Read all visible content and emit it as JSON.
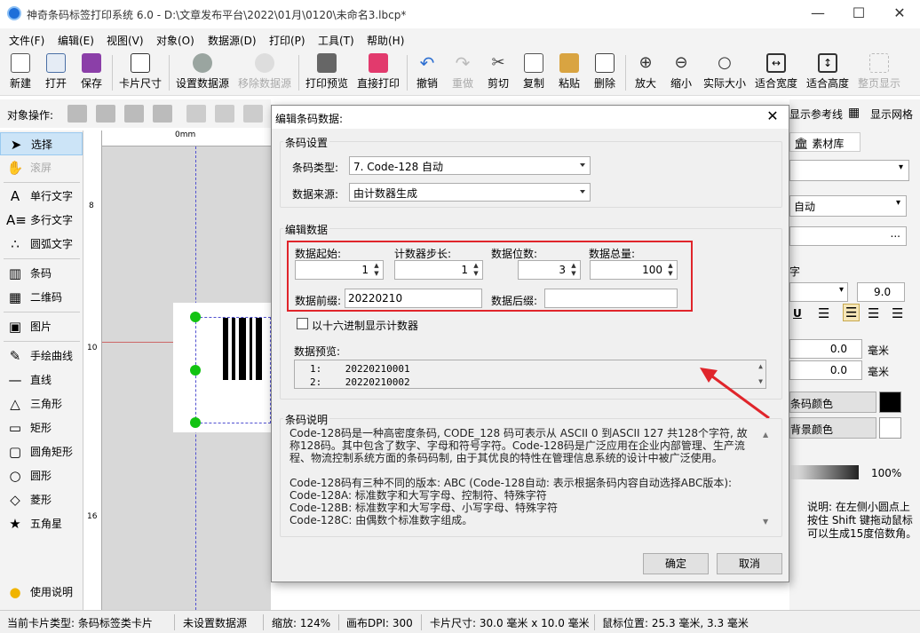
{
  "window": {
    "title": "神奇条码标签打印系统 6.0 - D:\\文章发布平台\\2022\\01月\\0120\\未命名3.lbcp*",
    "minimize": "—",
    "maximize": "☐",
    "close": "✕"
  },
  "menu": [
    "文件(F)",
    "编辑(E)",
    "视图(V)",
    "对象(O)",
    "数据源(D)",
    "打印(P)",
    "工具(T)",
    "帮助(H)"
  ],
  "toolbar": [
    "新建",
    "打开",
    "保存",
    "卡片尺寸",
    "设置数据源",
    "移除数据源",
    "打印预览",
    "直接打印",
    "撤销",
    "重做",
    "剪切",
    "复制",
    "粘贴",
    "删除",
    "放大",
    "缩小",
    "实际大小",
    "适合宽度",
    "适合高度",
    "整页显示"
  ],
  "objbar": {
    "label": "对象操作:"
  },
  "tools": [
    "选择",
    "滚屏",
    "单行文字",
    "多行文字",
    "圆弧文字",
    "条码",
    "二维码",
    "图片",
    "手绘曲线",
    "直线",
    "三角形",
    "矩形",
    "圆角矩形",
    "圆形",
    "菱形",
    "五角星",
    "使用说明"
  ],
  "ruler": {
    "top_zero": "0mm",
    "left_ticks": [
      "8",
      "10",
      "16"
    ]
  },
  "right_panel": {
    "show_ref": "显示参考线",
    "show_grid": "显示网格",
    "tab": "素材库",
    "combo2": "自动",
    "section": "字",
    "font_size": "9.0",
    "val1": "0.0",
    "val2": "0.0",
    "unit": "毫米",
    "barcode_color": "条码颜色",
    "bg_color": "背景颜色",
    "opacity": "100%",
    "note": "说明: 在左侧小圆点上按住 Shift 键拖动鼠标可以生成15度倍数角。",
    "ellipsis": "..."
  },
  "status": {
    "card_type": "当前卡片类型: 条码标签类卡片",
    "datasource": "未设置数据源",
    "zoom": "缩放: 124%",
    "dpi": "画布DPI: 300",
    "size": "卡片尺寸: 30.0 毫米 x 10.0 毫米",
    "mouse": "鼠标位置: 25.3 毫米, 3.3 毫米"
  },
  "dialog": {
    "title": "编辑条码数据:",
    "close": "✕",
    "barcode_settings": {
      "group": "条码设置",
      "type_label": "条码类型:",
      "type_value": "7. Code-128 自动",
      "source_label": "数据来源:",
      "source_value": "由计数器生成"
    },
    "edit_data": {
      "group": "编辑数据",
      "start_label": "数据起始:",
      "start_value": "1",
      "step_label": "计数器步长:",
      "step_value": "1",
      "digits_label": "数据位数:",
      "digits_value": "3",
      "total_label": "数据总量:",
      "total_value": "100",
      "prefix_label": "数据前缀:",
      "prefix_value": "20220210",
      "suffix_label": "数据后缀:",
      "suffix_value": "",
      "hex_label": "以十六进制显示计数器",
      "preview_label": "数据预览:",
      "preview": [
        {
          "n": "1:",
          "v": "20220210001"
        },
        {
          "n": "2:",
          "v": "20220210002"
        }
      ]
    },
    "description": {
      "group": "条码说明",
      "p1": "Code-128码是一种高密度条码, CODE_128 码可表示从 ASCII 0 到ASCII 127 共128个字符, 故称128码。其中包含了数字、字母和符号字符。Code-128码是广泛应用在企业内部管理、生产流程、物流控制系统方面的条码码制, 由于其优良的特性在管理信息系统的设计中被广泛使用。",
      "p2": "Code-128码有三种不同的版本: ABC (Code-128自动: 表示根据条码内容自动选择ABC版本):",
      "l1": "Code-128A: 标准数字和大写字母、控制符、特殊字符",
      "l2": "Code-128B: 标准数字和大写字母、小写字母、特殊字符",
      "l3": "Code-128C: 由偶数个标准数字组成。"
    },
    "ok": "确定",
    "cancel": "取消"
  },
  "colors": {
    "accent": "#e0252b",
    "selection": "#cce4f7"
  }
}
